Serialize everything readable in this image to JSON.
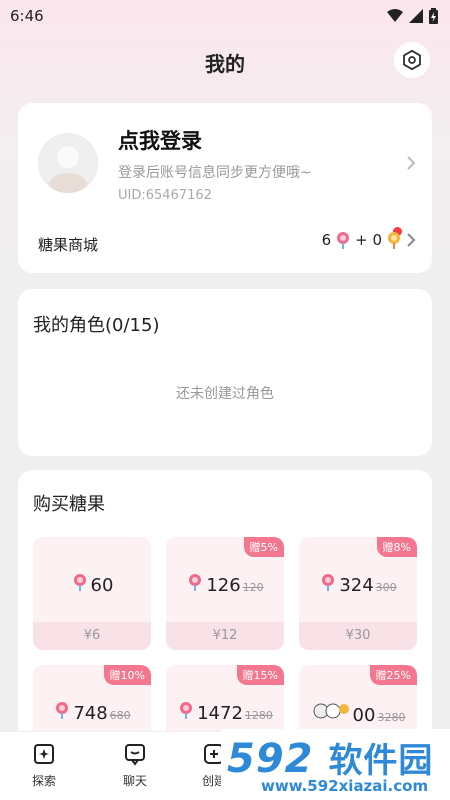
{
  "status_bar": {
    "time": "6:46"
  },
  "header": {
    "title": "我的"
  },
  "profile": {
    "login_title": "点我登录",
    "login_subtitle": "登录后账号信息同步更方便哦~",
    "uid": "UID:65467162",
    "store_label": "糖果商城",
    "candy_count": "6",
    "plus_text": "+ 0"
  },
  "roles": {
    "title": "我的角色(0/15)",
    "empty_text": "还未创建过角色"
  },
  "buy": {
    "title": "购买糖果",
    "packages": [
      {
        "amount": "60",
        "old": "",
        "price": "¥6",
        "badge": ""
      },
      {
        "amount": "126",
        "old": "120",
        "price": "¥12",
        "badge": "赠5%"
      },
      {
        "amount": "324",
        "old": "300",
        "price": "¥30",
        "badge": "赠8%"
      },
      {
        "amount": "748",
        "old": "680",
        "price": "",
        "badge": "赠10%"
      },
      {
        "amount": "1472",
        "old": "1280",
        "price": "",
        "badge": "赠15%"
      },
      {
        "amount": "00",
        "old": "3280",
        "price": "",
        "badge": "赠25%"
      }
    ]
  },
  "nav": {
    "explore": "探索",
    "chat": "聊天",
    "create": "创建"
  },
  "watermark": {
    "top": "592",
    "top_cn": "软件园",
    "bottom": "www.592xiazai.com"
  },
  "colors": {
    "accent": "#f3788f",
    "price_bg": "#f9e1e8",
    "pkg_bg": "#fdf1f4",
    "watermark": "#2e8ad8"
  }
}
